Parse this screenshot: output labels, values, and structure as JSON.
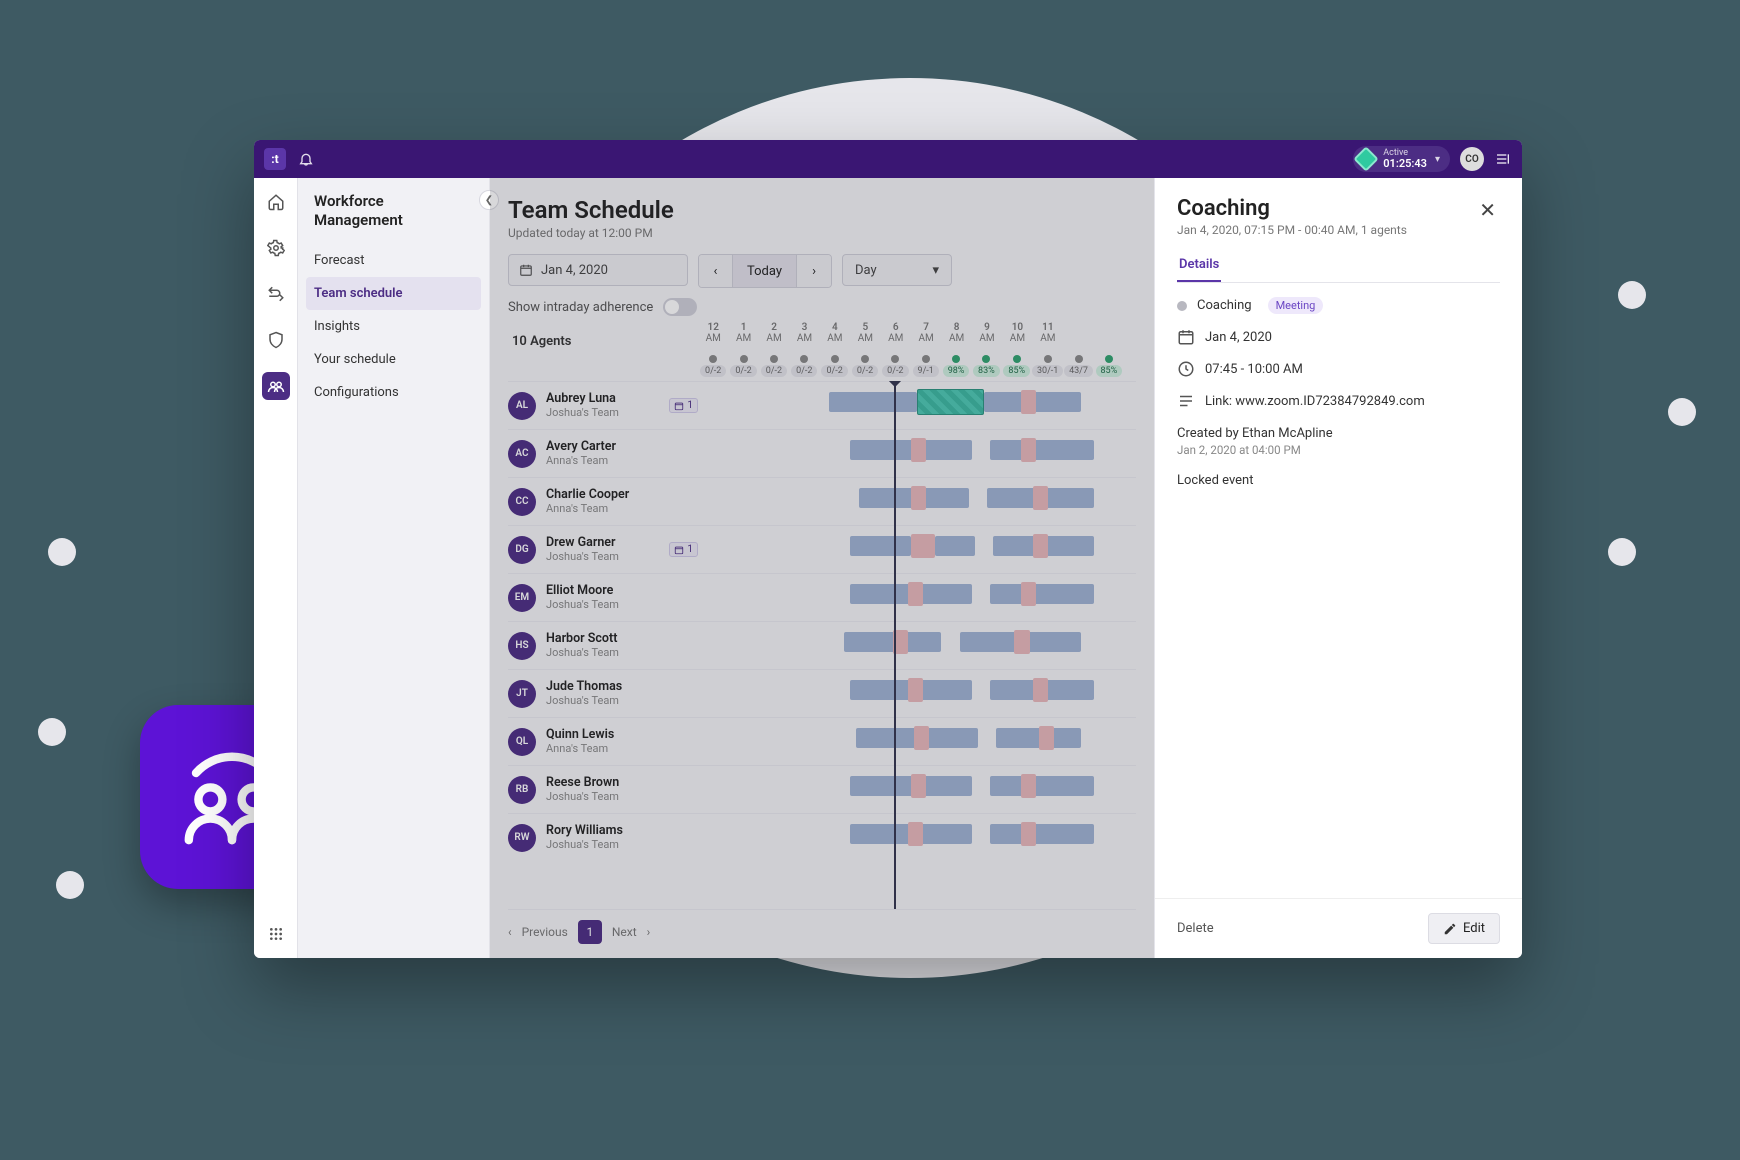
{
  "colors": {
    "brand": "#4c2d84",
    "accent": "#5d13d6",
    "teal": "#4cc9b4"
  },
  "topbar": {
    "logo_letter": ":t",
    "status_label": "Active",
    "status_timer": "01:25:43",
    "avatar_initials": "CO"
  },
  "sidebar": {
    "section_title": "Workforce Management",
    "items": [
      {
        "label": "Forecast"
      },
      {
        "label": "Team schedule"
      },
      {
        "label": "Insights"
      },
      {
        "label": "Your schedule"
      },
      {
        "label": "Configurations"
      }
    ],
    "active_index": 1
  },
  "page": {
    "title": "Team Schedule",
    "updated": "Updated today at 12:00 PM"
  },
  "toolbar": {
    "date_label": "Jan 4, 2020",
    "today_label": "Today",
    "view_label": "Day",
    "adherence_label": "Show intraday adherence"
  },
  "timeline": {
    "agents_count_label": "10 Agents",
    "now_hour_fraction": 0.46,
    "hours": [
      "12 AM",
      "1 AM",
      "2 AM",
      "3 AM",
      "4 AM",
      "5 AM",
      "6 AM",
      "7 AM",
      "8 AM",
      "9 AM",
      "10 AM",
      "11 AM"
    ],
    "stats": [
      {
        "v": "0/-2",
        "g": 0
      },
      {
        "v": "0/-2",
        "g": 0
      },
      {
        "v": "0/-2",
        "g": 0
      },
      {
        "v": "0/-2",
        "g": 0
      },
      {
        "v": "0/-2",
        "g": 0
      },
      {
        "v": "0/-2",
        "g": 0
      },
      {
        "v": "0/-2",
        "g": 0
      },
      {
        "v": "9/-1",
        "g": 0
      },
      {
        "v": "98%",
        "g": 1
      },
      {
        "v": "83%",
        "g": 1
      },
      {
        "v": "85%",
        "g": 1
      },
      {
        "v": "30/-1",
        "g": 0
      },
      {
        "v": "43/7",
        "g": 0
      },
      {
        "v": "85%",
        "g": 1
      }
    ],
    "agents": [
      {
        "initials": "AL",
        "name": "Aubrey Luna",
        "team": "Joshua's Team",
        "badge": "1",
        "bars": [
          {
            "t": "blue",
            "s": 4.3,
            "e": 7.2
          },
          {
            "t": "teal",
            "s": 7.2,
            "e": 9.4
          },
          {
            "t": "blue",
            "s": 9.4,
            "e": 12.6
          },
          {
            "t": "pink",
            "s": 10.6,
            "e": 11.1
          }
        ]
      },
      {
        "initials": "AC",
        "name": "Avery Carter",
        "team": "Anna's Team",
        "bars": [
          {
            "t": "blue",
            "s": 5.0,
            "e": 9.0
          },
          {
            "t": "pink",
            "s": 7.0,
            "e": 7.5
          },
          {
            "t": "blue",
            "s": 9.6,
            "e": 13.0
          },
          {
            "t": "pink",
            "s": 10.6,
            "e": 11.1
          }
        ]
      },
      {
        "initials": "CC",
        "name": "Charlie Cooper",
        "team": "Anna's Team",
        "bars": [
          {
            "t": "blue",
            "s": 5.3,
            "e": 8.9
          },
          {
            "t": "pink",
            "s": 7.0,
            "e": 7.5
          },
          {
            "t": "blue",
            "s": 9.5,
            "e": 13.0
          },
          {
            "t": "pink",
            "s": 11.0,
            "e": 11.5
          }
        ]
      },
      {
        "initials": "DG",
        "name": "Drew Garner",
        "team": "Joshua's Team",
        "badge": "1",
        "bars": [
          {
            "t": "blue",
            "s": 5.0,
            "e": 7.0
          },
          {
            "t": "pink",
            "s": 7.0,
            "e": 7.8
          },
          {
            "t": "blue",
            "s": 7.8,
            "e": 9.1
          },
          {
            "t": "blue",
            "s": 9.7,
            "e": 13.0
          },
          {
            "t": "pink",
            "s": 11.0,
            "e": 11.5
          }
        ]
      },
      {
        "initials": "EM",
        "name": "Elliot Moore",
        "team": "Joshua's Team",
        "bars": [
          {
            "t": "blue",
            "s": 5.0,
            "e": 9.0
          },
          {
            "t": "pink",
            "s": 6.9,
            "e": 7.4
          },
          {
            "t": "blue",
            "s": 9.6,
            "e": 13.0
          },
          {
            "t": "pink",
            "s": 10.6,
            "e": 11.1
          }
        ]
      },
      {
        "initials": "HS",
        "name": "Harbor Scott",
        "team": "Joshua's Team",
        "bars": [
          {
            "t": "blue",
            "s": 4.8,
            "e": 8.0
          },
          {
            "t": "pink",
            "s": 6.4,
            "e": 6.9
          },
          {
            "t": "blue",
            "s": 8.6,
            "e": 12.6
          },
          {
            "t": "pink",
            "s": 10.4,
            "e": 10.9
          }
        ]
      },
      {
        "initials": "JT",
        "name": "Jude Thomas",
        "team": "Joshua's Team",
        "bars": [
          {
            "t": "blue",
            "s": 5.0,
            "e": 9.0
          },
          {
            "t": "pink",
            "s": 6.9,
            "e": 7.4
          },
          {
            "t": "blue",
            "s": 9.6,
            "e": 13.0
          },
          {
            "t": "pink",
            "s": 11.0,
            "e": 11.5
          }
        ]
      },
      {
        "initials": "QL",
        "name": "Quinn Lewis",
        "team": "Anna's Team",
        "bars": [
          {
            "t": "blue",
            "s": 5.2,
            "e": 9.2
          },
          {
            "t": "pink",
            "s": 7.1,
            "e": 7.6
          },
          {
            "t": "blue",
            "s": 9.8,
            "e": 12.6
          },
          {
            "t": "pink",
            "s": 11.2,
            "e": 11.7
          }
        ]
      },
      {
        "initials": "RB",
        "name": "Reese Brown",
        "team": "Joshua's Team",
        "bars": [
          {
            "t": "blue",
            "s": 5.0,
            "e": 9.0
          },
          {
            "t": "pink",
            "s": 7.0,
            "e": 7.5
          },
          {
            "t": "blue",
            "s": 9.6,
            "e": 13.0
          },
          {
            "t": "pink",
            "s": 10.6,
            "e": 11.1
          }
        ]
      },
      {
        "initials": "RW",
        "name": "Rory Williams",
        "team": "Joshua's Team",
        "bars": [
          {
            "t": "blue",
            "s": 5.0,
            "e": 9.0
          },
          {
            "t": "pink",
            "s": 6.9,
            "e": 7.4
          },
          {
            "t": "blue",
            "s": 9.6,
            "e": 13.0
          },
          {
            "t": "pink",
            "s": 10.6,
            "e": 11.1
          }
        ]
      }
    ]
  },
  "pager": {
    "previous": "Previous",
    "current": "1",
    "next": "Next"
  },
  "panel": {
    "title": "Coaching",
    "subtitle": "Jan 4, 2020, 07:15 PM - 00:40 AM, 1 agents",
    "tab_label": "Details",
    "event_type": "Coaching",
    "event_pill": "Meeting",
    "date": "Jan 4, 2020",
    "time": "07:45 - 10:00 AM",
    "link_label": "Link: www.zoom.ID72384792849.com",
    "created_by": "Created by Ethan McApline",
    "created_at": "Jan 2, 2020 at 04:00 PM",
    "locked": "Locked event",
    "delete_label": "Delete",
    "edit_label": "Edit"
  }
}
